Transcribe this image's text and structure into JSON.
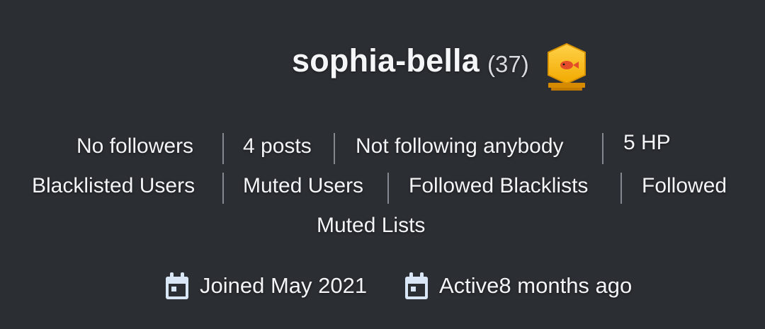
{
  "profile": {
    "username": "sophia-bella",
    "reputation": "(37)",
    "badge_icon": "fish-badge-icon"
  },
  "stats": {
    "followers": "No followers",
    "posts": "4 posts",
    "following": "Not following anybody",
    "hp": "5 HP",
    "blacklisted_users": "Blacklisted Users",
    "muted_users": "Muted Users",
    "followed_blacklists": "Followed Blacklists",
    "followed": "Followed",
    "muted_lists": "Muted Lists"
  },
  "meta": {
    "joined": "Joined May 2021",
    "active": "Active8 months ago"
  },
  "colors": {
    "background": "#2b2e33",
    "badge": "#f2b400",
    "text": "#f4f6f8"
  }
}
